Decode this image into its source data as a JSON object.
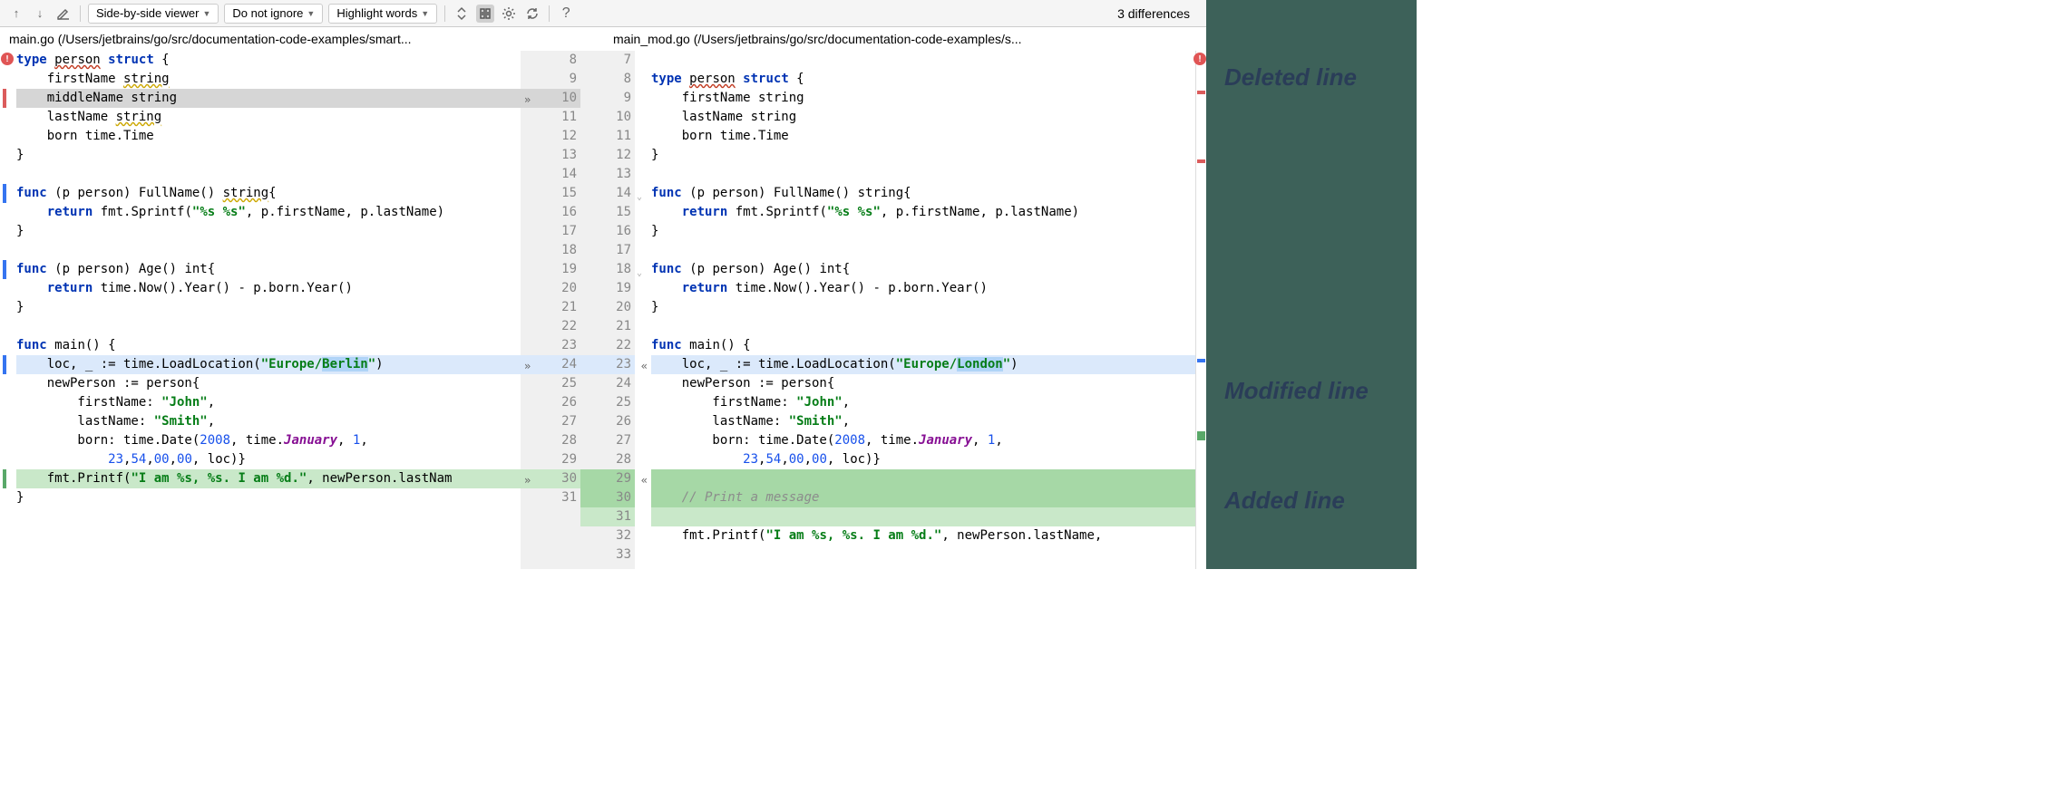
{
  "toolbar": {
    "viewer_mode": "Side-by-side viewer",
    "ignore_mode": "Do not ignore",
    "highlight_mode": "Highlight words",
    "diff_count": "3 differences"
  },
  "files": {
    "left": "main.go (/Users/jetbrains/go/src/documentation-code-examples/smart...",
    "right": "main_mod.go (/Users/jetbrains/go/src/documentation-code-examples/s..."
  },
  "legend": {
    "deleted": "Deleted line",
    "modified": "Modified line",
    "added": "Added line"
  },
  "left_lines": [
    {
      "n": 8,
      "kind": "",
      "tokens": [
        {
          "t": "type ",
          "c": "kw"
        },
        {
          "t": "person",
          "c": "err-squiggle"
        },
        {
          "t": " ",
          "c": ""
        },
        {
          "t": "struct",
          "c": "kw"
        },
        {
          "t": " {",
          "c": ""
        }
      ]
    },
    {
      "n": 9,
      "kind": "",
      "tokens": [
        {
          "t": "    firstName ",
          "c": ""
        },
        {
          "t": "string",
          "c": "warn-squiggle"
        }
      ]
    },
    {
      "n": 10,
      "kind": "del",
      "tokens": [
        {
          "t": "    middleName string",
          "c": ""
        }
      ]
    },
    {
      "n": 11,
      "kind": "",
      "tokens": [
        {
          "t": "    lastName ",
          "c": ""
        },
        {
          "t": "string",
          "c": "warn-squiggle"
        }
      ]
    },
    {
      "n": 12,
      "kind": "",
      "tokens": [
        {
          "t": "    born time.Time",
          "c": ""
        }
      ]
    },
    {
      "n": 13,
      "kind": "",
      "tokens": [
        {
          "t": "}",
          "c": ""
        }
      ]
    },
    {
      "n": 14,
      "kind": "",
      "tokens": [
        {
          "t": "",
          "c": ""
        }
      ]
    },
    {
      "n": 15,
      "kind": "",
      "tokens": [
        {
          "t": "func ",
          "c": "kw"
        },
        {
          "t": "(p person) FullName() ",
          "c": ""
        },
        {
          "t": "string",
          "c": "warn-squiggle"
        },
        {
          "t": "{",
          "c": ""
        }
      ]
    },
    {
      "n": 16,
      "kind": "",
      "tokens": [
        {
          "t": "    ",
          "c": ""
        },
        {
          "t": "return ",
          "c": "kw"
        },
        {
          "t": "fmt.Sprintf(",
          "c": ""
        },
        {
          "t": "\"%s %s\"",
          "c": "str"
        },
        {
          "t": ", p.firstName, p.lastName)",
          "c": ""
        }
      ]
    },
    {
      "n": 17,
      "kind": "",
      "tokens": [
        {
          "t": "}",
          "c": ""
        }
      ]
    },
    {
      "n": 18,
      "kind": "",
      "tokens": [
        {
          "t": "",
          "c": ""
        }
      ]
    },
    {
      "n": 19,
      "kind": "",
      "tokens": [
        {
          "t": "func ",
          "c": "kw"
        },
        {
          "t": "(p person) Age() int{",
          "c": ""
        }
      ]
    },
    {
      "n": 20,
      "kind": "",
      "tokens": [
        {
          "t": "    ",
          "c": ""
        },
        {
          "t": "return ",
          "c": "kw"
        },
        {
          "t": "time.Now().Year() - p.born.Year()",
          "c": ""
        }
      ]
    },
    {
      "n": 21,
      "kind": "",
      "tokens": [
        {
          "t": "}",
          "c": ""
        }
      ]
    },
    {
      "n": 22,
      "kind": "",
      "tokens": [
        {
          "t": "",
          "c": ""
        }
      ]
    },
    {
      "n": 23,
      "kind": "",
      "tokens": [
        {
          "t": "func ",
          "c": "kw"
        },
        {
          "t": "main() {",
          "c": ""
        }
      ]
    },
    {
      "n": 24,
      "kind": "mod",
      "tokens": [
        {
          "t": "    loc, _ := time.LoadLocation(",
          "c": ""
        },
        {
          "t": "\"Europe/",
          "c": "str"
        },
        {
          "t": "Berlin",
          "c": "str word-diff"
        },
        {
          "t": "\"",
          "c": "str"
        },
        {
          "t": ")",
          "c": ""
        }
      ]
    },
    {
      "n": 25,
      "kind": "",
      "tokens": [
        {
          "t": "    newPerson := person{",
          "c": ""
        }
      ]
    },
    {
      "n": 26,
      "kind": "",
      "tokens": [
        {
          "t": "        firstName: ",
          "c": ""
        },
        {
          "t": "\"John\"",
          "c": "str"
        },
        {
          "t": ",",
          "c": ""
        }
      ]
    },
    {
      "n": 27,
      "kind": "",
      "tokens": [
        {
          "t": "        lastName: ",
          "c": ""
        },
        {
          "t": "\"Smith\"",
          "c": "str"
        },
        {
          "t": ",",
          "c": ""
        }
      ]
    },
    {
      "n": 28,
      "kind": "",
      "tokens": [
        {
          "t": "        born: time.Date(",
          "c": ""
        },
        {
          "t": "2008",
          "c": "num"
        },
        {
          "t": ", time.",
          "c": ""
        },
        {
          "t": "January",
          "c": "em-purple"
        },
        {
          "t": ", ",
          "c": ""
        },
        {
          "t": "1",
          "c": "num"
        },
        {
          "t": ",",
          "c": ""
        }
      ]
    },
    {
      "n": 29,
      "kind": "",
      "tokens": [
        {
          "t": "            ",
          "c": ""
        },
        {
          "t": "23",
          "c": "num"
        },
        {
          "t": ",",
          "c": ""
        },
        {
          "t": "54",
          "c": "num"
        },
        {
          "t": ",",
          "c": ""
        },
        {
          "t": "00",
          "c": "num"
        },
        {
          "t": ",",
          "c": ""
        },
        {
          "t": "00",
          "c": "num"
        },
        {
          "t": ", loc)}",
          "c": ""
        }
      ]
    },
    {
      "n": 30,
      "kind": "add",
      "tokens": [
        {
          "t": "    fmt.Printf(",
          "c": ""
        },
        {
          "t": "\"I am %s, %s. I am %d.\"",
          "c": "str"
        },
        {
          "t": ", newPerson.lastNam",
          "c": ""
        }
      ]
    },
    {
      "n": 31,
      "kind": "",
      "tokens": [
        {
          "t": "}",
          "c": ""
        }
      ]
    }
  ],
  "right_lines": [
    {
      "n": 7,
      "kind": "",
      "tokens": [
        {
          "t": "",
          "c": ""
        }
      ]
    },
    {
      "n": 8,
      "kind": "",
      "tokens": [
        {
          "t": "type ",
          "c": "kw"
        },
        {
          "t": "person",
          "c": "err-squiggle"
        },
        {
          "t": " ",
          "c": ""
        },
        {
          "t": "struct",
          "c": "kw"
        },
        {
          "t": " {",
          "c": ""
        }
      ]
    },
    {
      "n": 9,
      "kind": "",
      "tokens": [
        {
          "t": "    firstName string",
          "c": ""
        }
      ]
    },
    {
      "n": 10,
      "kind": "",
      "tokens": [
        {
          "t": "    lastName string",
          "c": ""
        }
      ]
    },
    {
      "n": 11,
      "kind": "",
      "tokens": [
        {
          "t": "    born time.Time",
          "c": ""
        }
      ]
    },
    {
      "n": 12,
      "kind": "",
      "tokens": [
        {
          "t": "}",
          "c": ""
        }
      ]
    },
    {
      "n": 13,
      "kind": "",
      "tokens": [
        {
          "t": "",
          "c": ""
        }
      ]
    },
    {
      "n": 14,
      "kind": "",
      "tokens": [
        {
          "t": "func ",
          "c": "kw"
        },
        {
          "t": "(p person) FullName() string{",
          "c": ""
        }
      ]
    },
    {
      "n": 15,
      "kind": "",
      "tokens": [
        {
          "t": "    ",
          "c": ""
        },
        {
          "t": "return ",
          "c": "kw"
        },
        {
          "t": "fmt.Sprintf(",
          "c": ""
        },
        {
          "t": "\"%s %s\"",
          "c": "str"
        },
        {
          "t": ", p.firstName, p.lastName)",
          "c": ""
        }
      ]
    },
    {
      "n": 16,
      "kind": "",
      "tokens": [
        {
          "t": "}",
          "c": ""
        }
      ]
    },
    {
      "n": 17,
      "kind": "",
      "tokens": [
        {
          "t": "",
          "c": ""
        }
      ]
    },
    {
      "n": 18,
      "kind": "",
      "tokens": [
        {
          "t": "func ",
          "c": "kw"
        },
        {
          "t": "(p person) Age() int{",
          "c": ""
        }
      ]
    },
    {
      "n": 19,
      "kind": "",
      "tokens": [
        {
          "t": "    ",
          "c": ""
        },
        {
          "t": "return ",
          "c": "kw"
        },
        {
          "t": "time.Now().Year() - p.born.Year()",
          "c": ""
        }
      ]
    },
    {
      "n": 20,
      "kind": "",
      "tokens": [
        {
          "t": "}",
          "c": ""
        }
      ]
    },
    {
      "n": 21,
      "kind": "",
      "tokens": [
        {
          "t": "",
          "c": ""
        }
      ]
    },
    {
      "n": 22,
      "kind": "",
      "tokens": [
        {
          "t": "func ",
          "c": "kw"
        },
        {
          "t": "main() {",
          "c": ""
        }
      ]
    },
    {
      "n": 23,
      "kind": "mod",
      "tokens": [
        {
          "t": "    loc, _ := time.LoadLocation(",
          "c": ""
        },
        {
          "t": "\"Europe/",
          "c": "str"
        },
        {
          "t": "London",
          "c": "str word-diff"
        },
        {
          "t": "\"",
          "c": "str"
        },
        {
          "t": ")",
          "c": ""
        }
      ]
    },
    {
      "n": 24,
      "kind": "",
      "tokens": [
        {
          "t": "    newPerson := person{",
          "c": ""
        }
      ]
    },
    {
      "n": 25,
      "kind": "",
      "tokens": [
        {
          "t": "        firstName: ",
          "c": ""
        },
        {
          "t": "\"John\"",
          "c": "str"
        },
        {
          "t": ",",
          "c": ""
        }
      ]
    },
    {
      "n": 26,
      "kind": "",
      "tokens": [
        {
          "t": "        lastName: ",
          "c": ""
        },
        {
          "t": "\"Smith\"",
          "c": "str"
        },
        {
          "t": ",",
          "c": ""
        }
      ]
    },
    {
      "n": 27,
      "kind": "",
      "tokens": [
        {
          "t": "        born: time.Date(",
          "c": ""
        },
        {
          "t": "2008",
          "c": "num"
        },
        {
          "t": ", time.",
          "c": ""
        },
        {
          "t": "January",
          "c": "em-purple"
        },
        {
          "t": ", ",
          "c": ""
        },
        {
          "t": "1",
          "c": "num"
        },
        {
          "t": ",",
          "c": ""
        }
      ]
    },
    {
      "n": 28,
      "kind": "",
      "tokens": [
        {
          "t": "            ",
          "c": ""
        },
        {
          "t": "23",
          "c": "num"
        },
        {
          "t": ",",
          "c": ""
        },
        {
          "t": "54",
          "c": "num"
        },
        {
          "t": ",",
          "c": ""
        },
        {
          "t": "00",
          "c": "num"
        },
        {
          "t": ",",
          "c": ""
        },
        {
          "t": "00",
          "c": "num"
        },
        {
          "t": ", loc)}",
          "c": ""
        }
      ]
    },
    {
      "n": 29,
      "kind": "add-dark",
      "tokens": [
        {
          "t": "",
          "c": ""
        }
      ]
    },
    {
      "n": 30,
      "kind": "add-dark",
      "tokens": [
        {
          "t": "    ",
          "c": ""
        },
        {
          "t": "// Print a message",
          "c": "comment"
        }
      ]
    },
    {
      "n": 31,
      "kind": "add",
      "tokens": [
        {
          "t": "",
          "c": ""
        }
      ]
    },
    {
      "n": 32,
      "kind": "",
      "tokens": [
        {
          "t": "    fmt.Printf(",
          "c": ""
        },
        {
          "t": "\"I am %s, %s. I am %d.\"",
          "c": "str"
        },
        {
          "t": ", newPerson.lastName,",
          "c": ""
        }
      ]
    },
    {
      "n": 33,
      "kind": "",
      "tokens": [
        {
          "t": "",
          "c": ""
        }
      ]
    }
  ]
}
